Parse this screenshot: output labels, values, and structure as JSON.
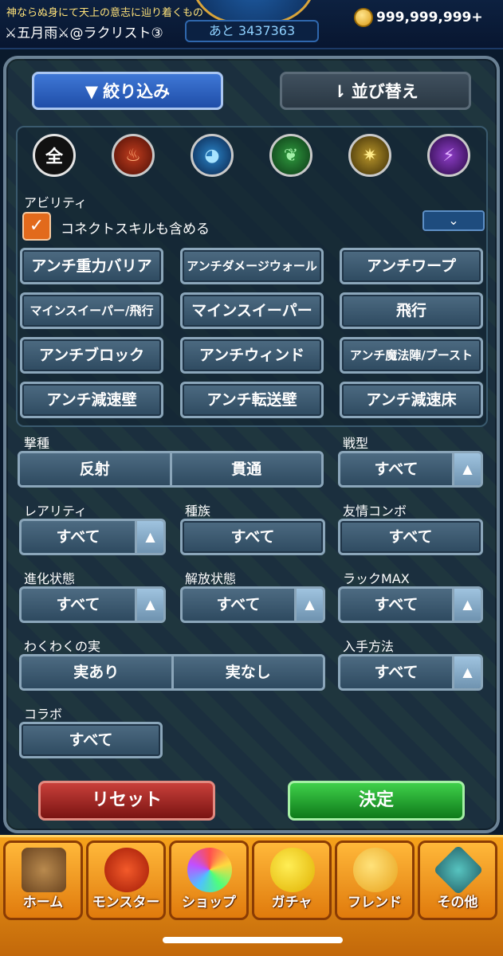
{
  "header": {
    "player_title": "神ならぬ身にて天上の意志に辿り着くもの",
    "player_name": "⚔五月雨⚔@ラクリスト③",
    "exp_remaining": "あと 3437363",
    "coins": "999,999,999+"
  },
  "tabs": {
    "filter": "絞り込み",
    "sort": "並び替え",
    "filter_icon": "▼",
    "sort_icon": "⇂"
  },
  "elements": {
    "all": "全",
    "fire": "♨",
    "water": "◕",
    "wood": "❦",
    "light": "✷",
    "dark": "⚡"
  },
  "ability": {
    "section_label": "アビリティ",
    "connect_skill_label": "コネクトスキルも含める",
    "connect_skill_checked": true,
    "checkmark": "✓",
    "expand_icon": "⌄",
    "buttons": [
      "アンチ重力バリア",
      "アンチダメージウォール",
      "アンチワープ",
      "マインスイーパー/飛行",
      "マインスイーパー",
      "飛行",
      "アンチブロック",
      "アンチウィンド",
      "アンチ魔法陣/ブースト",
      "アンチ減速壁",
      "アンチ転送壁",
      "アンチ減速床"
    ]
  },
  "filters": {
    "geki_label": "撃種",
    "geki_options": [
      "反射",
      "貫通"
    ],
    "sentai_label": "戦型",
    "sentai_value": "すべて",
    "rarity_label": "レアリティ",
    "rarity_value": "すべて",
    "race_label": "種族",
    "race_value": "すべて",
    "combo_label": "友情コンボ",
    "combo_value": "すべて",
    "evo_label": "進化状態",
    "evo_value": "すべて",
    "release_label": "解放状態",
    "release_value": "すべて",
    "luck_label": "ラックMAX",
    "luck_value": "すべて",
    "fruit_label": "わくわくの実",
    "fruit_options": [
      "実あり",
      "実なし"
    ],
    "obtain_label": "入手方法",
    "obtain_value": "すべて",
    "collab_label": "コラボ",
    "collab_value": "すべて",
    "arrow": "▲"
  },
  "actions": {
    "reset": "リセット",
    "confirm": "決定"
  },
  "nav": [
    "ホーム",
    "モンスター",
    "ショップ",
    "ガチャ",
    "フレンド",
    "その他"
  ]
}
